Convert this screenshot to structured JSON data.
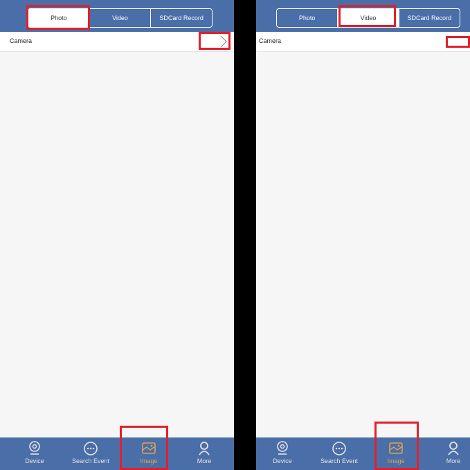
{
  "left": {
    "tabs": [
      "Photo",
      "Video",
      "SDCard Record"
    ],
    "active_tab": "Photo",
    "row_label": "Camera",
    "nav": [
      "Device",
      "Search Event",
      "Image",
      "More"
    ],
    "active_nav": "Image"
  },
  "right": {
    "tabs": [
      "Photo",
      "Video",
      "SDCard Record"
    ],
    "active_tab": "Video",
    "row_label": "Camera",
    "nav": [
      "Device",
      "Search Event",
      "Image",
      "More"
    ],
    "active_nav": "Image"
  },
  "colors": {
    "header": "#4a6ea8",
    "highlight": "#e0212b",
    "active_nav": "#e3a44a",
    "divider": "#000000"
  },
  "icons": [
    "camera-icon",
    "chat-icon",
    "image-icon",
    "person-icon",
    "chevron-right-icon"
  ]
}
